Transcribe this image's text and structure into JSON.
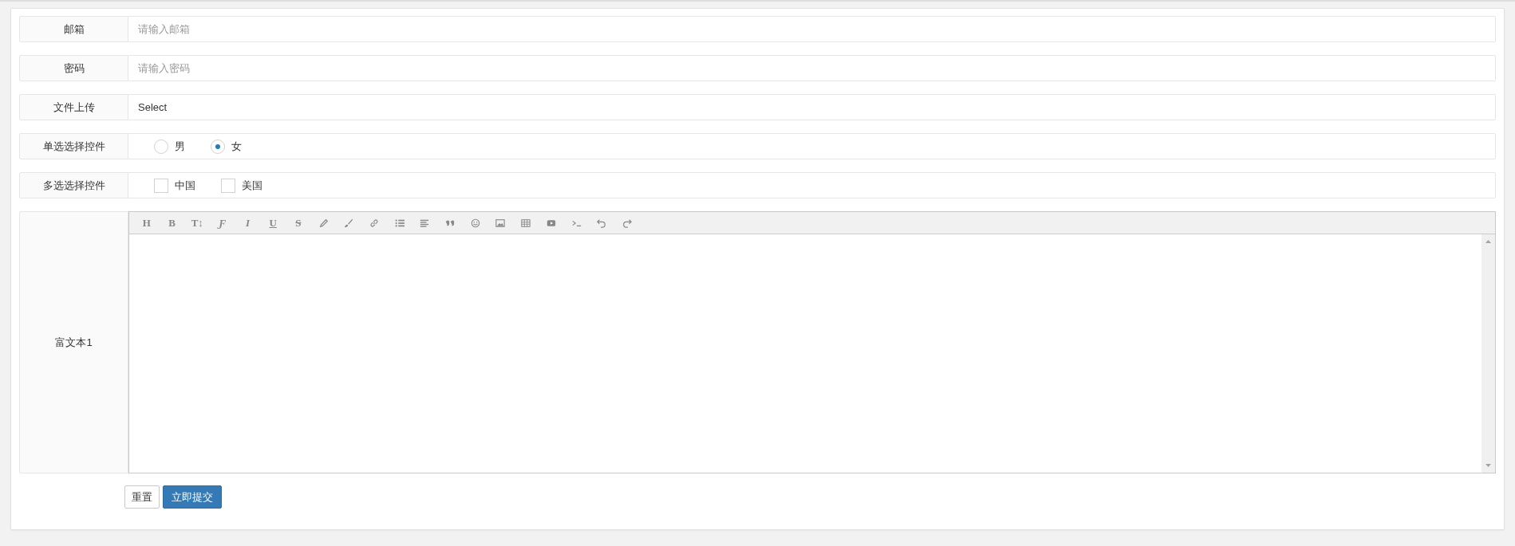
{
  "fields": [
    {
      "kind": "text",
      "label": "邮箱",
      "placeholder": "请输入邮箱"
    },
    {
      "kind": "password",
      "label": "密码",
      "placeholder": "请输入密码"
    },
    {
      "kind": "file",
      "label": "文件上传",
      "value": "Select"
    },
    {
      "kind": "radio",
      "label": "单选选择控件",
      "options": [
        {
          "label": "男",
          "selected": false
        },
        {
          "label": "女",
          "selected": true
        }
      ]
    },
    {
      "kind": "checkbox",
      "label": "多选选择控件",
      "options": [
        {
          "label": "中国",
          "checked": false
        },
        {
          "label": "美国",
          "checked": false
        }
      ]
    }
  ],
  "editor": {
    "label": "富文本1",
    "toolbar_glyphs": [
      "H",
      "B",
      "T↕",
      "Ƒ",
      "I",
      "U",
      "S"
    ]
  },
  "buttons": [
    {
      "label": "重置",
      "kind": "reset"
    },
    {
      "label": "立即提交",
      "kind": "submit"
    }
  ]
}
